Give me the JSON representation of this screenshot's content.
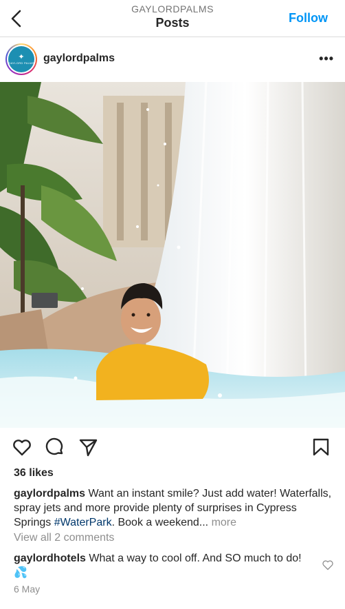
{
  "header": {
    "subtitle": "GAYLORDPALMS",
    "title": "Posts",
    "follow_label": "Follow"
  },
  "post": {
    "username": "gaylordpalms",
    "avatar": {
      "text": "GAYLORD PALMS",
      "color": "#1d8fb2"
    },
    "more_label": "•••",
    "likes": "36 likes",
    "caption": {
      "username": "gaylordpalms",
      "text_before": "Want an instant smile? Just add water! Waterfalls, spray jets and more provide plenty of surprises in Cypress Springs",
      "hashtag": "#WaterPark",
      "text_after": ". Book a weekend...",
      "more_label": "more"
    },
    "view_comments": "View all 2 comments",
    "comment": {
      "username": "gaylordhotels",
      "text": "What a way to cool off. And SO much to do! 💦"
    },
    "date": "6 May"
  },
  "icons": {
    "back": "chevron-left-icon",
    "like": "heart-icon",
    "comment": "speech-bubble-icon",
    "share": "paper-plane-icon",
    "save": "bookmark-icon",
    "comment_like": "heart-icon"
  },
  "colors": {
    "accent": "#0095f6",
    "hashtag": "#00376b",
    "muted": "#8e8e8e",
    "text": "#262626"
  }
}
